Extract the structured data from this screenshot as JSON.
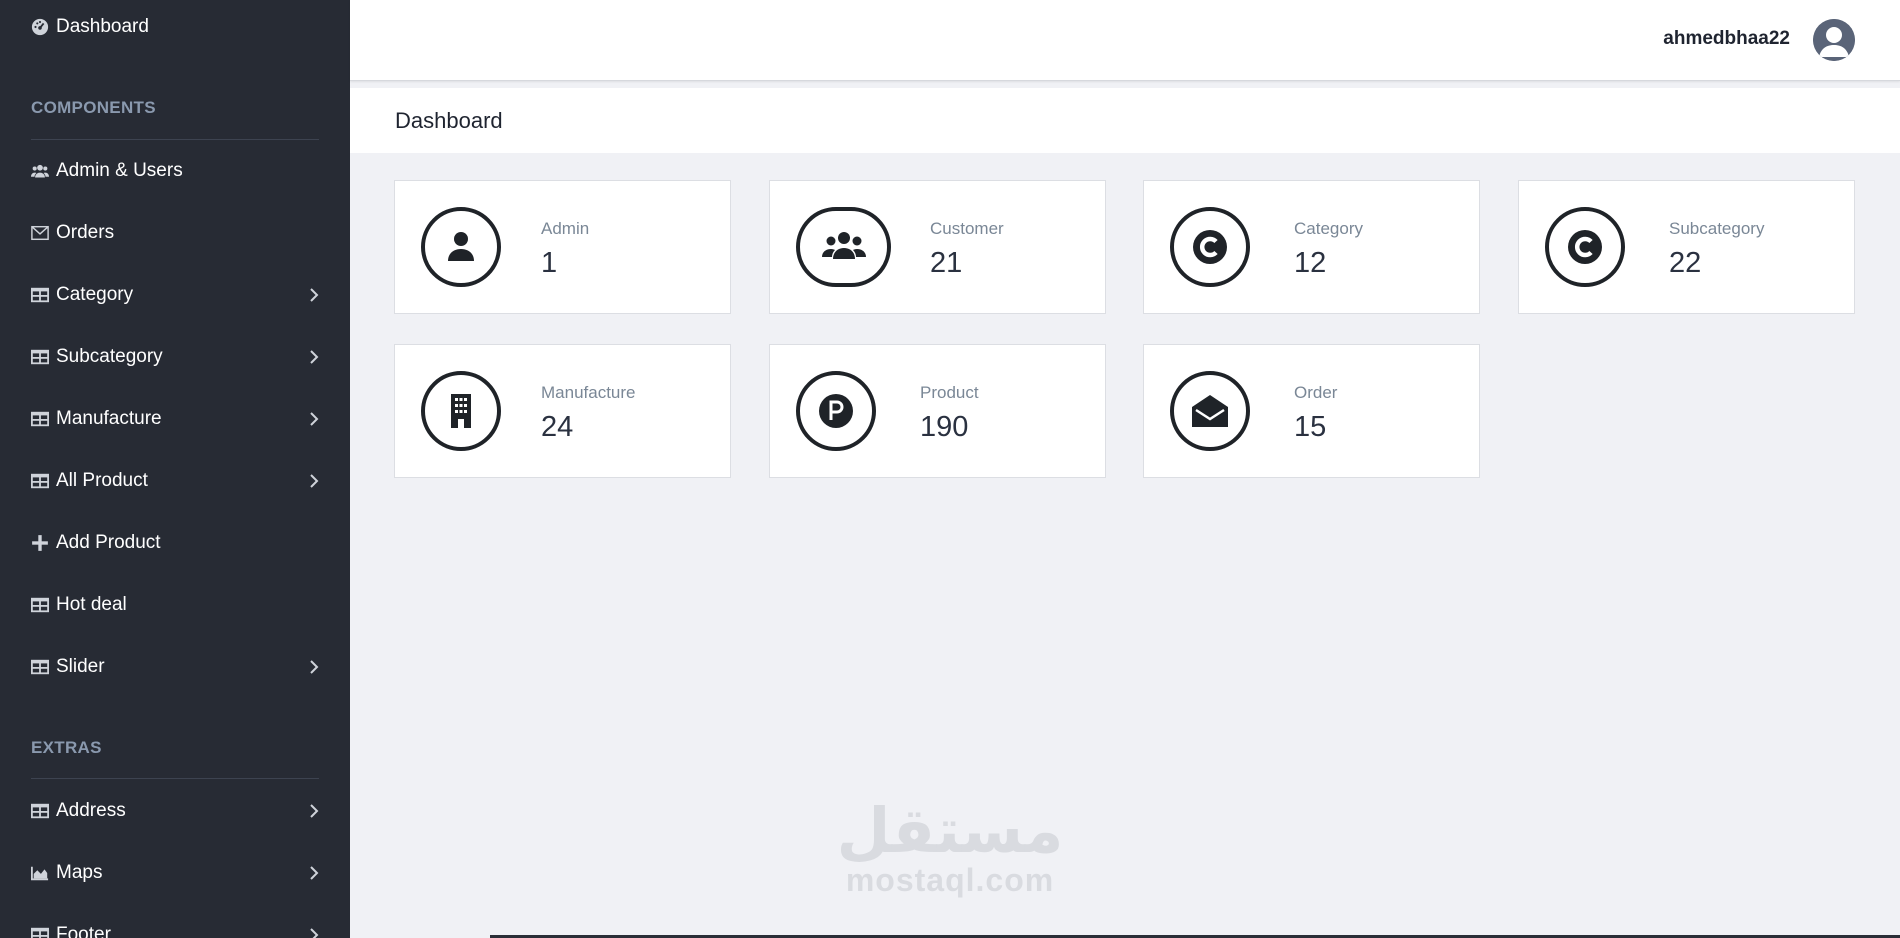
{
  "sidebar": {
    "dashboard_label": "Dashboard",
    "sections": [
      {
        "title": "COMPONENTS"
      },
      {
        "title": "EXTRAS"
      }
    ],
    "items": [
      {
        "label": "Admin & Users",
        "icon": "users-icon",
        "has_chevron": false
      },
      {
        "label": "Orders",
        "icon": "envelope-icon",
        "has_chevron": false
      },
      {
        "label": "Category",
        "icon": "table-icon",
        "has_chevron": true
      },
      {
        "label": "Subcategory",
        "icon": "table-icon",
        "has_chevron": true
      },
      {
        "label": "Manufacture",
        "icon": "table-icon",
        "has_chevron": true
      },
      {
        "label": "All Product",
        "icon": "table-icon",
        "has_chevron": true
      },
      {
        "label": "Add Product",
        "icon": "plus-icon",
        "has_chevron": false
      },
      {
        "label": "Hot deal",
        "icon": "table-icon",
        "has_chevron": false
      },
      {
        "label": "Slider",
        "icon": "table-icon",
        "has_chevron": true
      }
    ],
    "extras": [
      {
        "label": "Address",
        "icon": "table-icon",
        "has_chevron": true
      },
      {
        "label": "Maps",
        "icon": "area-chart-icon",
        "has_chevron": true
      },
      {
        "label": "Footer",
        "icon": "table-icon",
        "has_chevron": true
      }
    ]
  },
  "topbar": {
    "username": "ahmedbhaa22",
    "avatar_icon": "user-avatar-icon"
  },
  "page": {
    "title": "Dashboard"
  },
  "cards": [
    {
      "label": "Admin",
      "value": "1",
      "icon": "user-icon"
    },
    {
      "label": "Customer",
      "value": "21",
      "icon": "users-icon"
    },
    {
      "label": "Category",
      "value": "12",
      "icon": "copyright-icon"
    },
    {
      "label": "Subcategory",
      "value": "22",
      "icon": "copyright-icon"
    },
    {
      "label": "Manufacture",
      "value": "24",
      "icon": "building-icon"
    },
    {
      "label": "Product",
      "value": "190",
      "icon": "product-p-icon"
    },
    {
      "label": "Order",
      "value": "15",
      "icon": "envelope-open-icon"
    }
  ],
  "watermark": {
    "arabic": "مستقل",
    "latin": "mostaql.com"
  },
  "colors": {
    "sidebar_bg": "#272b34",
    "page_bg": "#f0f1f5",
    "section_heading": "#8a99ae",
    "card_label": "#7a8796"
  }
}
